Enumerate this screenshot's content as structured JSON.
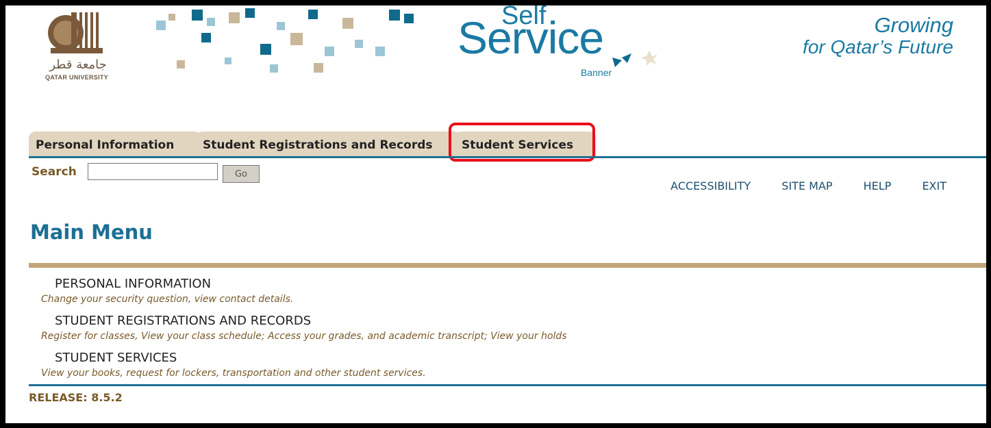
{
  "header": {
    "logo_arabic": "جامعة قطر",
    "logo_english": "QATAR UNIVERSITY",
    "ss_self": "Self",
    "ss_service": "Service",
    "ss_banner": "Banner",
    "tagline_line1": "Growing",
    "tagline_line2": "for Qatar’s Future"
  },
  "tabs": [
    {
      "label": "Personal Information"
    },
    {
      "label": "Student Registrations and Records"
    },
    {
      "label": "Student Services",
      "highlighted": true
    }
  ],
  "search": {
    "label": "Search",
    "value": "",
    "go_label": "Go"
  },
  "top_links": [
    {
      "label": "ACCESSIBILITY"
    },
    {
      "label": "SITE MAP"
    },
    {
      "label": "HELP"
    },
    {
      "label": "EXIT"
    }
  ],
  "main_title": "Main Menu",
  "menu": [
    {
      "title": "PERSONAL INFORMATION",
      "description": "Change your security question, view contact details."
    },
    {
      "title": "STUDENT REGISTRATIONS AND RECORDS",
      "description": "Register for classes, View your class schedule; Access your grades, and academic transcript; View your holds"
    },
    {
      "title": "STUDENT SERVICES",
      "description": "View your books, request for lockers, transportation and other student services."
    }
  ],
  "release": {
    "label": "RELEASE:",
    "value": "8.5.2"
  },
  "colors": {
    "teal": "#1d6f95",
    "tan": "#c2a57a",
    "tab_bg": "#e2d5c0",
    "highlight": "#e8101a",
    "brown_text": "#7a5a2a"
  }
}
